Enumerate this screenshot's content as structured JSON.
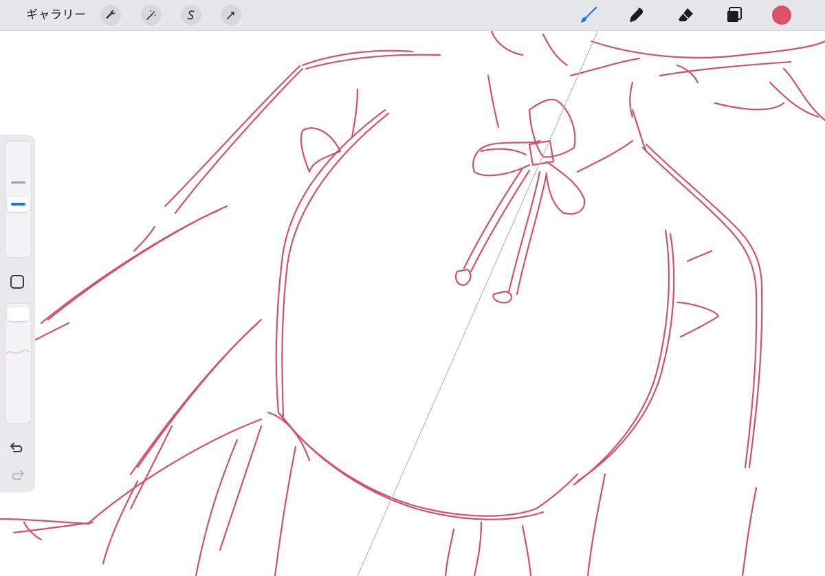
{
  "app": {
    "gallery_label": "ギャラリー"
  },
  "toolbar": {
    "left_tools": [
      {
        "name": "actions",
        "icon": "wrench-icon"
      },
      {
        "name": "adjustments",
        "icon": "magic-wand-icon"
      },
      {
        "name": "selection",
        "icon": "selection-s-icon"
      },
      {
        "name": "transform",
        "icon": "arrow-cursor-icon"
      }
    ],
    "right_tools": [
      {
        "name": "brush",
        "icon": "brush-icon",
        "active": true
      },
      {
        "name": "smudge",
        "icon": "smudge-icon",
        "active": false
      },
      {
        "name": "eraser",
        "icon": "eraser-icon",
        "active": false
      },
      {
        "name": "layers",
        "icon": "layers-icon",
        "active": false
      }
    ],
    "current_color": "#d95068"
  },
  "sidebar": {
    "brush_size_level": 0.45,
    "opacity_level": 1.0
  },
  "colors": {
    "accent": "#1478f0",
    "stroke": "#d45068",
    "toolbar_bg": "#e7e7e9",
    "sidebar_bg": "#e9e9eb"
  }
}
